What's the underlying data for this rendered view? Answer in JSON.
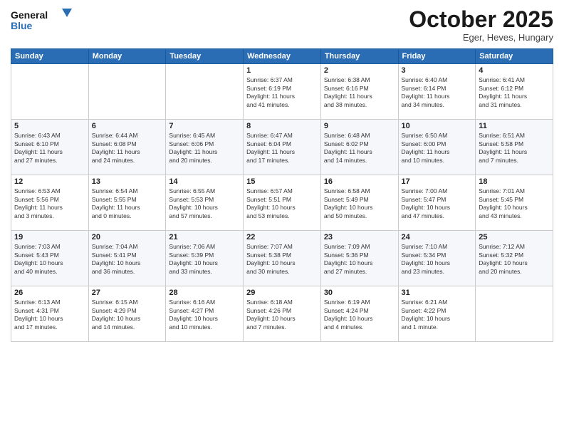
{
  "logo": {
    "line1": "General",
    "line2": "Blue"
  },
  "title": "October 2025",
  "subtitle": "Eger, Heves, Hungary",
  "days_of_week": [
    "Sunday",
    "Monday",
    "Tuesday",
    "Wednesday",
    "Thursday",
    "Friday",
    "Saturday"
  ],
  "weeks": [
    [
      {
        "day": "",
        "info": ""
      },
      {
        "day": "",
        "info": ""
      },
      {
        "day": "",
        "info": ""
      },
      {
        "day": "1",
        "info": "Sunrise: 6:37 AM\nSunset: 6:19 PM\nDaylight: 11 hours\nand 41 minutes."
      },
      {
        "day": "2",
        "info": "Sunrise: 6:38 AM\nSunset: 6:16 PM\nDaylight: 11 hours\nand 38 minutes."
      },
      {
        "day": "3",
        "info": "Sunrise: 6:40 AM\nSunset: 6:14 PM\nDaylight: 11 hours\nand 34 minutes."
      },
      {
        "day": "4",
        "info": "Sunrise: 6:41 AM\nSunset: 6:12 PM\nDaylight: 11 hours\nand 31 minutes."
      }
    ],
    [
      {
        "day": "5",
        "info": "Sunrise: 6:43 AM\nSunset: 6:10 PM\nDaylight: 11 hours\nand 27 minutes."
      },
      {
        "day": "6",
        "info": "Sunrise: 6:44 AM\nSunset: 6:08 PM\nDaylight: 11 hours\nand 24 minutes."
      },
      {
        "day": "7",
        "info": "Sunrise: 6:45 AM\nSunset: 6:06 PM\nDaylight: 11 hours\nand 20 minutes."
      },
      {
        "day": "8",
        "info": "Sunrise: 6:47 AM\nSunset: 6:04 PM\nDaylight: 11 hours\nand 17 minutes."
      },
      {
        "day": "9",
        "info": "Sunrise: 6:48 AM\nSunset: 6:02 PM\nDaylight: 11 hours\nand 14 minutes."
      },
      {
        "day": "10",
        "info": "Sunrise: 6:50 AM\nSunset: 6:00 PM\nDaylight: 11 hours\nand 10 minutes."
      },
      {
        "day": "11",
        "info": "Sunrise: 6:51 AM\nSunset: 5:58 PM\nDaylight: 11 hours\nand 7 minutes."
      }
    ],
    [
      {
        "day": "12",
        "info": "Sunrise: 6:53 AM\nSunset: 5:56 PM\nDaylight: 11 hours\nand 3 minutes."
      },
      {
        "day": "13",
        "info": "Sunrise: 6:54 AM\nSunset: 5:55 PM\nDaylight: 11 hours\nand 0 minutes."
      },
      {
        "day": "14",
        "info": "Sunrise: 6:55 AM\nSunset: 5:53 PM\nDaylight: 10 hours\nand 57 minutes."
      },
      {
        "day": "15",
        "info": "Sunrise: 6:57 AM\nSunset: 5:51 PM\nDaylight: 10 hours\nand 53 minutes."
      },
      {
        "day": "16",
        "info": "Sunrise: 6:58 AM\nSunset: 5:49 PM\nDaylight: 10 hours\nand 50 minutes."
      },
      {
        "day": "17",
        "info": "Sunrise: 7:00 AM\nSunset: 5:47 PM\nDaylight: 10 hours\nand 47 minutes."
      },
      {
        "day": "18",
        "info": "Sunrise: 7:01 AM\nSunset: 5:45 PM\nDaylight: 10 hours\nand 43 minutes."
      }
    ],
    [
      {
        "day": "19",
        "info": "Sunrise: 7:03 AM\nSunset: 5:43 PM\nDaylight: 10 hours\nand 40 minutes."
      },
      {
        "day": "20",
        "info": "Sunrise: 7:04 AM\nSunset: 5:41 PM\nDaylight: 10 hours\nand 36 minutes."
      },
      {
        "day": "21",
        "info": "Sunrise: 7:06 AM\nSunset: 5:39 PM\nDaylight: 10 hours\nand 33 minutes."
      },
      {
        "day": "22",
        "info": "Sunrise: 7:07 AM\nSunset: 5:38 PM\nDaylight: 10 hours\nand 30 minutes."
      },
      {
        "day": "23",
        "info": "Sunrise: 7:09 AM\nSunset: 5:36 PM\nDaylight: 10 hours\nand 27 minutes."
      },
      {
        "day": "24",
        "info": "Sunrise: 7:10 AM\nSunset: 5:34 PM\nDaylight: 10 hours\nand 23 minutes."
      },
      {
        "day": "25",
        "info": "Sunrise: 7:12 AM\nSunset: 5:32 PM\nDaylight: 10 hours\nand 20 minutes."
      }
    ],
    [
      {
        "day": "26",
        "info": "Sunrise: 6:13 AM\nSunset: 4:31 PM\nDaylight: 10 hours\nand 17 minutes."
      },
      {
        "day": "27",
        "info": "Sunrise: 6:15 AM\nSunset: 4:29 PM\nDaylight: 10 hours\nand 14 minutes."
      },
      {
        "day": "28",
        "info": "Sunrise: 6:16 AM\nSunset: 4:27 PM\nDaylight: 10 hours\nand 10 minutes."
      },
      {
        "day": "29",
        "info": "Sunrise: 6:18 AM\nSunset: 4:26 PM\nDaylight: 10 hours\nand 7 minutes."
      },
      {
        "day": "30",
        "info": "Sunrise: 6:19 AM\nSunset: 4:24 PM\nDaylight: 10 hours\nand 4 minutes."
      },
      {
        "day": "31",
        "info": "Sunrise: 6:21 AM\nSunset: 4:22 PM\nDaylight: 10 hours\nand 1 minute."
      },
      {
        "day": "",
        "info": ""
      }
    ]
  ]
}
